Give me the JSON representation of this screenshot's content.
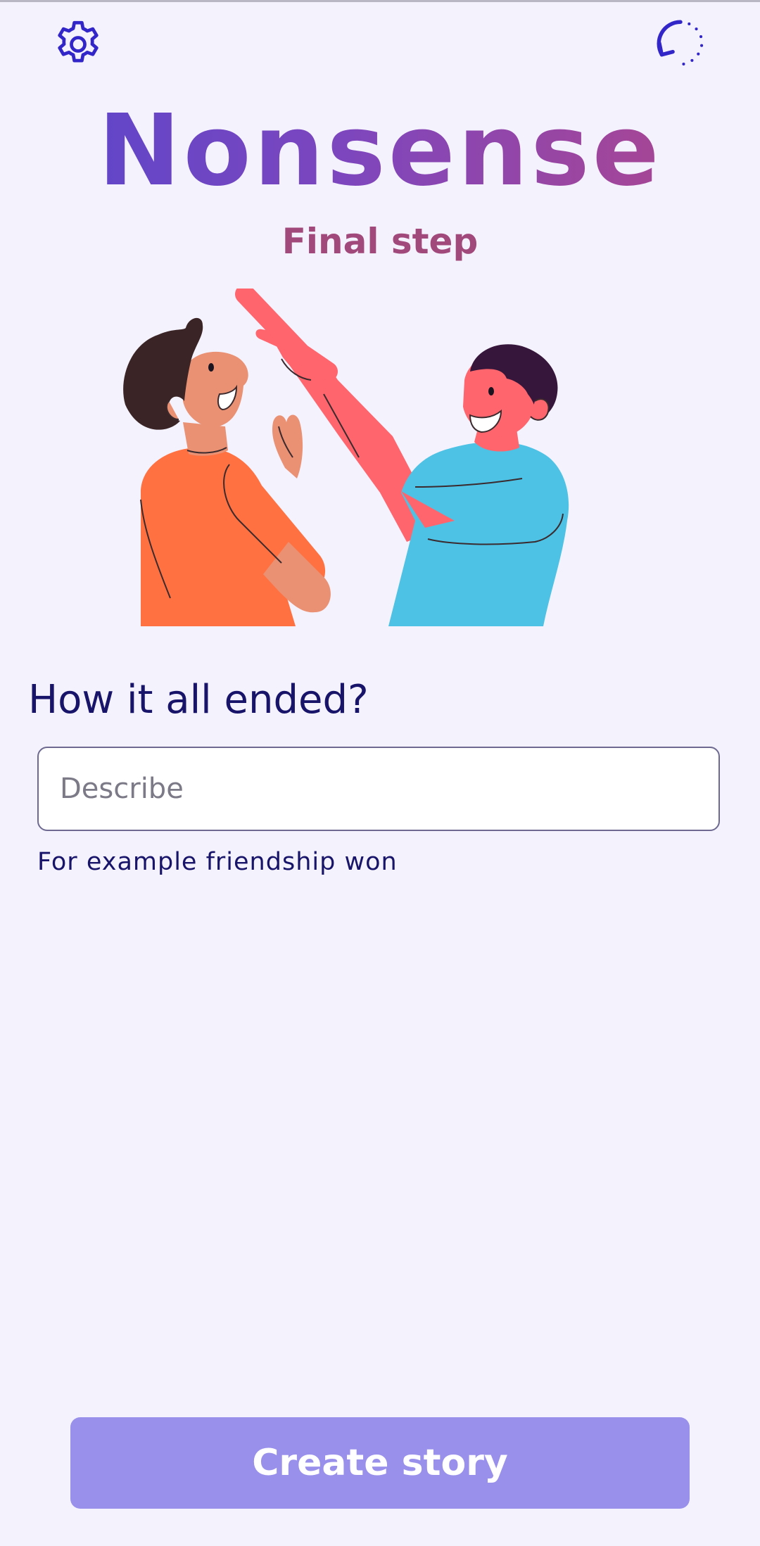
{
  "header": {
    "settings_icon": "gear-icon",
    "reset_icon": "restart-dotted-arrow-icon"
  },
  "app": {
    "title": "Nonsense",
    "step": "Final step"
  },
  "illustration": {
    "description_icon": "two-people-pointing-illustration"
  },
  "form": {
    "question": "How it all ended?",
    "input_placeholder": "Describe",
    "input_value": "",
    "helper_text": "For example friendship won"
  },
  "actions": {
    "create_label": "Create story"
  },
  "colors": {
    "background": "#f4f2fd",
    "title_gradient_start": "#5746cc",
    "title_gradient_end": "#b2468a",
    "step_text": "#a2497c",
    "primary_text": "#17146a",
    "button_bg": "#9990ec"
  }
}
